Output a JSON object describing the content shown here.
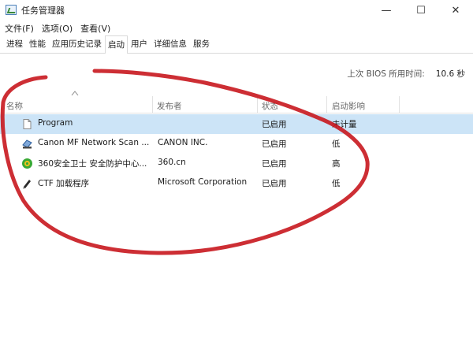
{
  "window": {
    "title": "任务管理器",
    "min_glyph": "—",
    "max_glyph": "☐",
    "close_glyph": "✕"
  },
  "menu": [
    "文件(F)",
    "选项(O)",
    "查看(V)"
  ],
  "tabs": [
    {
      "label": "进程",
      "active": false
    },
    {
      "label": "性能",
      "active": false
    },
    {
      "label": "应用历史记录",
      "active": false
    },
    {
      "label": "启动",
      "active": true
    },
    {
      "label": "用户",
      "active": false
    },
    {
      "label": "详细信息",
      "active": false
    },
    {
      "label": "服务",
      "active": false
    }
  ],
  "bios": {
    "label": "上次 BIOS 所用时间:",
    "value": "10.6 秒"
  },
  "columns": {
    "name": "名称",
    "publisher": "发布者",
    "status": "状态",
    "impact": "启动影响"
  },
  "rows": [
    {
      "icon": "file-icon",
      "name": "Program",
      "publisher": "",
      "status": "已启用",
      "impact": "未计量",
      "selected": true
    },
    {
      "icon": "scanner-icon",
      "name": "Canon MF Network Scan ...",
      "publisher": "CANON INC.",
      "status": "已启用",
      "impact": "低",
      "selected": false
    },
    {
      "icon": "shield-360-icon",
      "name": "360安全卫士 安全防护中心...",
      "publisher": "360.cn",
      "status": "已启用",
      "impact": "高",
      "selected": false
    },
    {
      "icon": "pen-icon",
      "name": "CTF 加载程序",
      "publisher": "Microsoft Corporation",
      "status": "已启用",
      "impact": "低",
      "selected": false
    }
  ],
  "colors": {
    "selection": "#cce4f7",
    "annotation": "#c8171e"
  }
}
